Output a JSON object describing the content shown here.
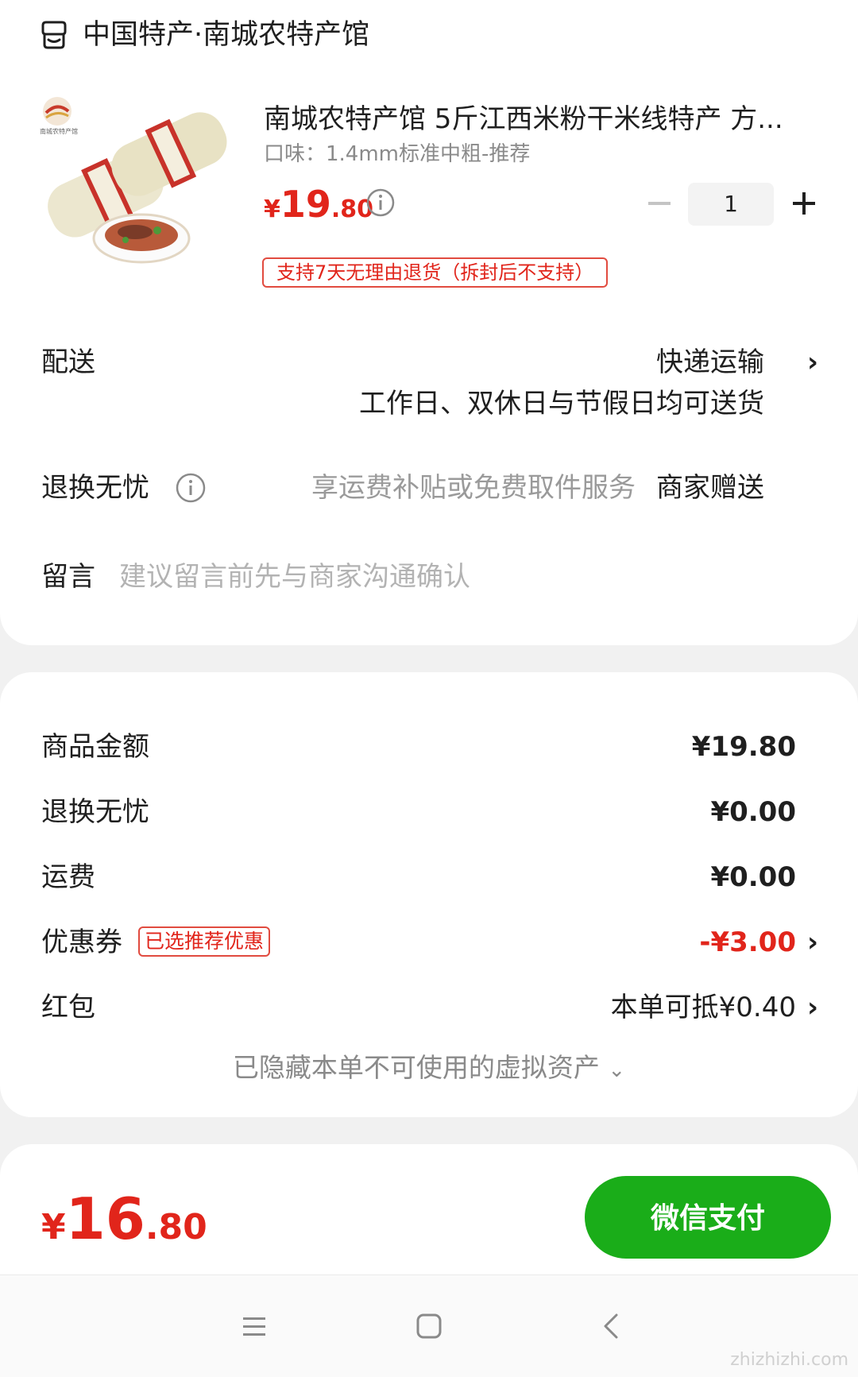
{
  "shop": {
    "name": "中国特产·南城农特产馆",
    "icon": "shop-icon"
  },
  "product": {
    "title": "南城农特产馆 5斤江西米粉干米线特产 方...",
    "spec": "口味：1.4mm标准中粗-推荐",
    "price_symbol": "¥",
    "price_int": "19",
    "price_dec": ".80",
    "quantity": "1",
    "return_tag": "支持7天无理由退货（拆封后不支持）",
    "image_logo_text": "南城农特产馆"
  },
  "delivery": {
    "label": "配送",
    "method": "快递运输",
    "note": "工作日、双休日与节假日均可送货"
  },
  "exchange": {
    "label": "退换无忧",
    "desc": "享运费补贴或免费取件服务",
    "value": "商家赠送"
  },
  "message": {
    "label": "留言",
    "placeholder": "建议留言前先与商家沟通确认"
  },
  "summary": {
    "goods_label": "商品金额",
    "goods_value": "¥19.80",
    "exchange_label": "退换无忧",
    "exchange_value": "¥0.00",
    "shipping_label": "运费",
    "shipping_value": "¥0.00",
    "coupon_label": "优惠券",
    "coupon_badge": "已选推荐优惠",
    "coupon_value": "-¥3.00",
    "redpack_label": "红包",
    "redpack_value": "本单可抵¥0.40",
    "hidden_note": "已隐藏本单不可使用的虚拟资产"
  },
  "footer": {
    "total_symbol": "¥",
    "total_int": "16",
    "total_dec": ".80",
    "pay_label": "微信支付"
  },
  "watermark": "zhizhizhi.com",
  "colors": {
    "accent_red": "#e1251b",
    "pay_green": "#1aad19",
    "background": "#f1f1f1"
  }
}
